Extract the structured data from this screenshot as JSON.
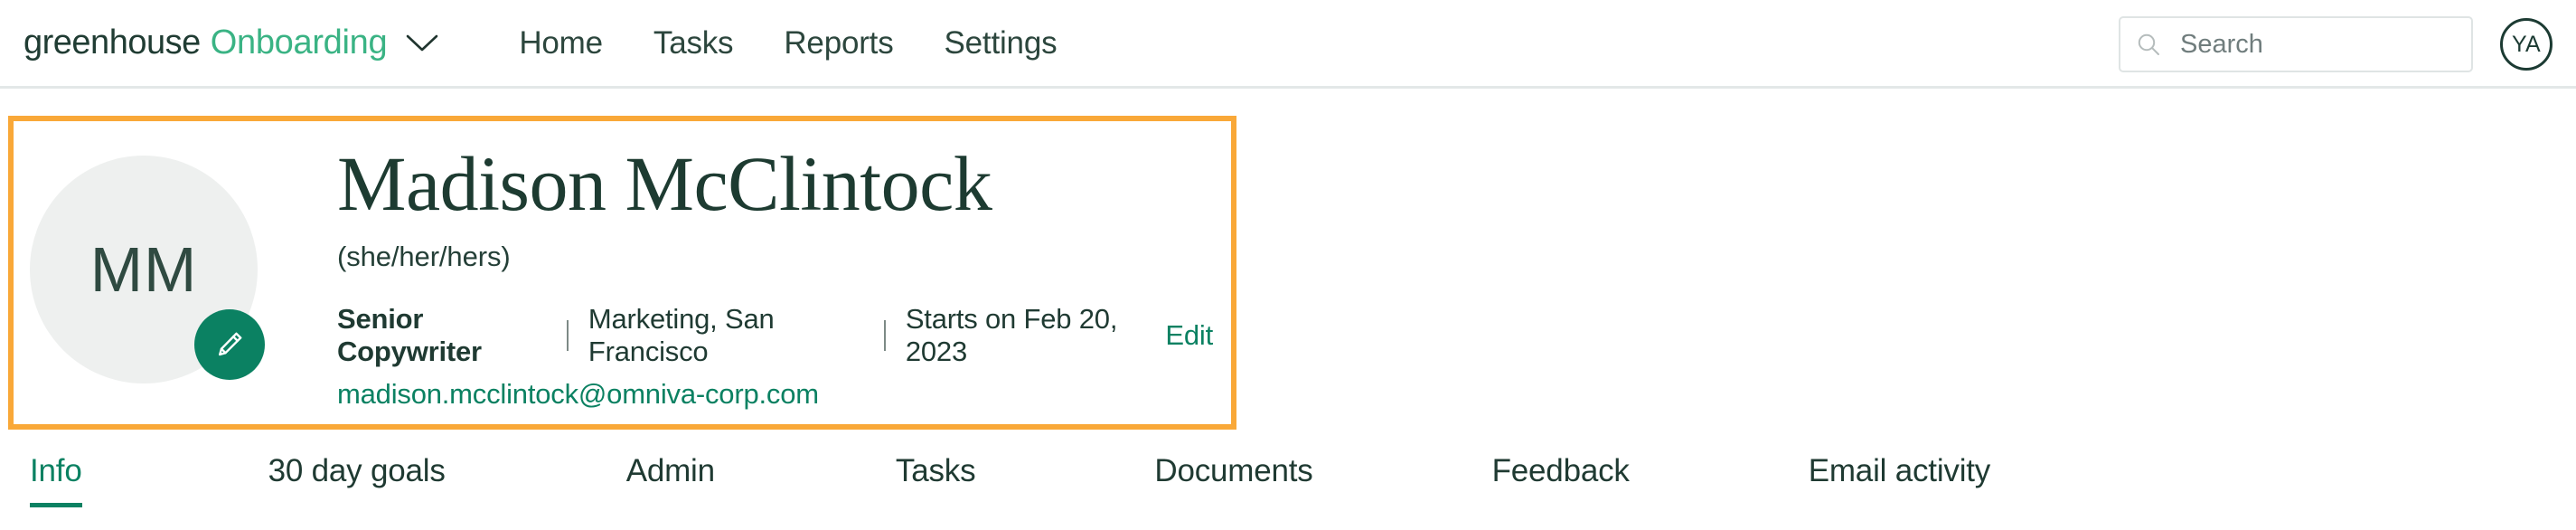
{
  "topbar": {
    "brand": {
      "company": "greenhouse",
      "product": "Onboarding",
      "chevron_icon": "chevron-down-icon"
    },
    "nav_items": [
      {
        "label": "Home"
      },
      {
        "label": "Tasks"
      },
      {
        "label": "Reports"
      },
      {
        "label": "Settings"
      }
    ],
    "search": {
      "icon": "search-icon",
      "value": "",
      "placeholder": "Search"
    },
    "user_avatar": {
      "initials": "YA"
    }
  },
  "profile": {
    "highlight_color": "#f9a838",
    "avatar": {
      "initials": "MM",
      "edit_badge_icon": "pencil-icon"
    },
    "name": "Madison McClintock",
    "pronouns": "(she/her/hers)",
    "meta": {
      "title": "Senior Copywriter",
      "department_location": "Marketing, San Francisco",
      "start_date": "Starts on Feb 20, 2023",
      "edit_label": "Edit"
    },
    "email": "madison.mcclintock@omniva-corp.com"
  },
  "tabs": [
    {
      "label": "Info",
      "active": true
    },
    {
      "label": "30 day goals",
      "active": false
    },
    {
      "label": "Admin",
      "active": false
    },
    {
      "label": "Tasks",
      "active": false
    },
    {
      "label": "Documents",
      "active": false
    },
    {
      "label": "Feedback",
      "active": false
    },
    {
      "label": "Email activity",
      "active": false
    }
  ],
  "colors": {
    "brand_green": "#3ab384",
    "dark_green": "#1d3b31",
    "link_green": "#0b8162",
    "highlight_orange": "#f9a838"
  }
}
